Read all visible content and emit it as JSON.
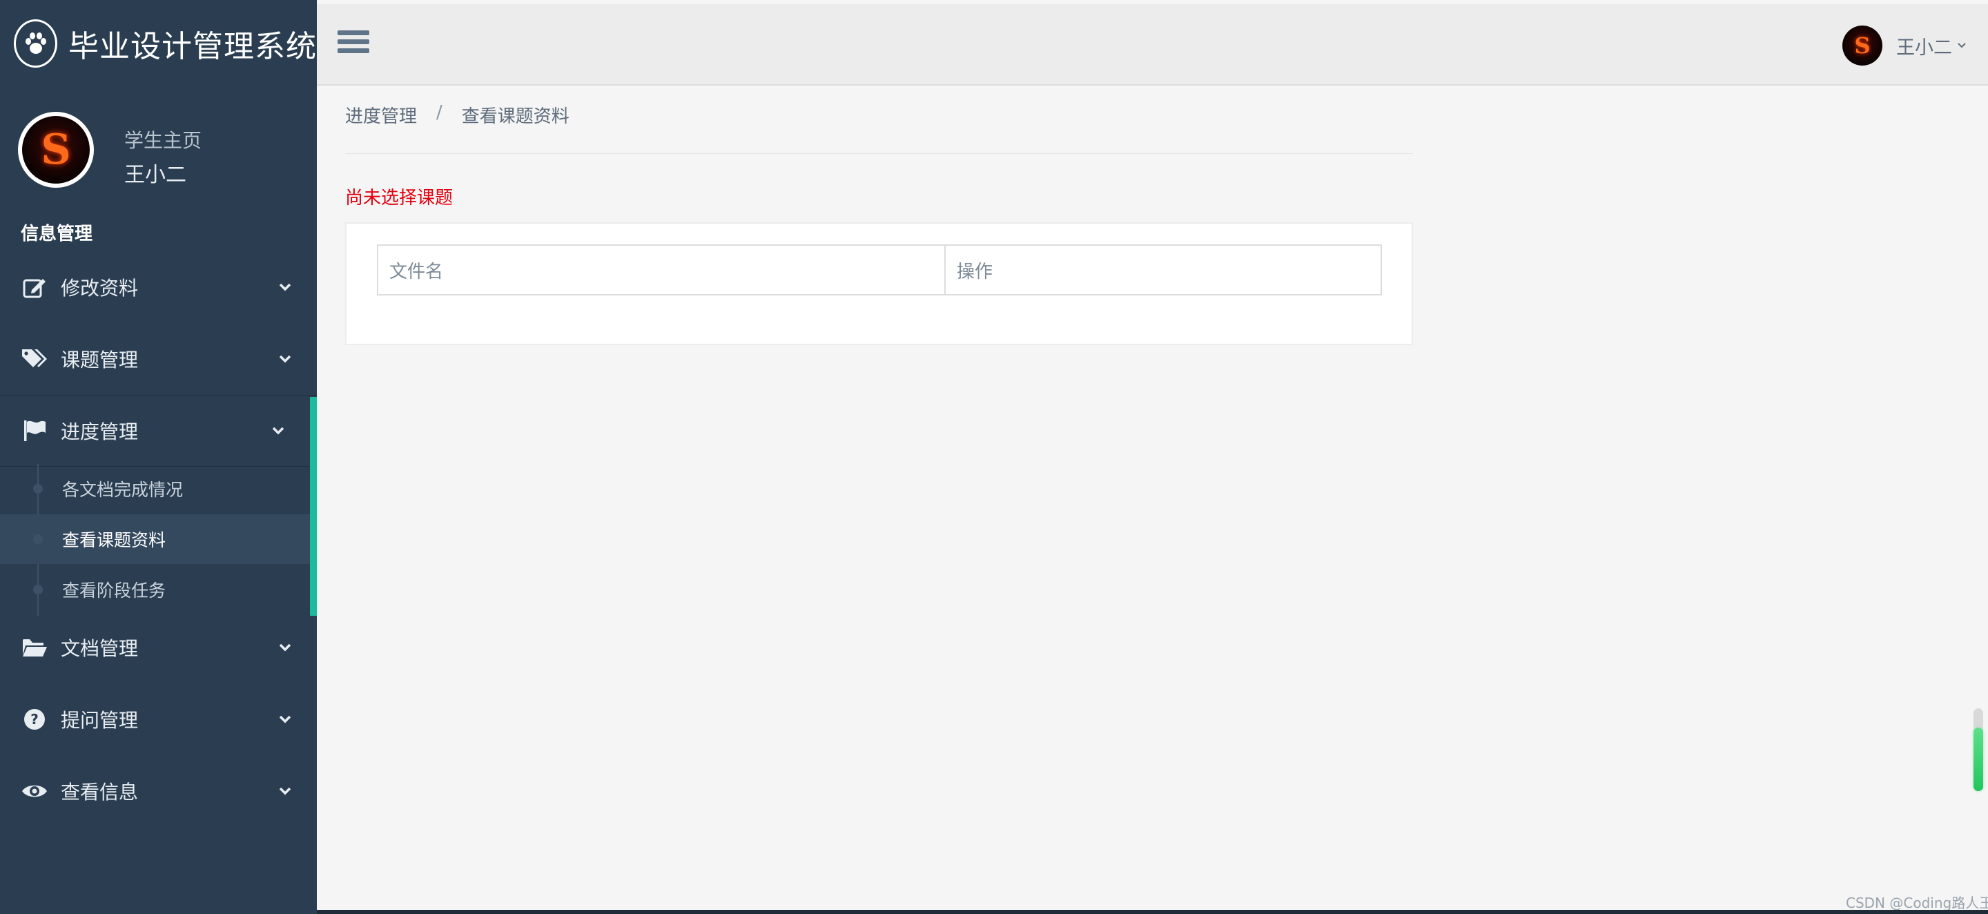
{
  "app": {
    "title": "毕业设计管理系统",
    "logo_icon": "paw-icon"
  },
  "profile": {
    "role": "学生主页",
    "name": "王小二",
    "avatar_letter": "S"
  },
  "sidebar": {
    "section_title": "信息管理",
    "items": [
      {
        "label": "修改资料",
        "icon": "edit-icon"
      },
      {
        "label": "课题管理",
        "icon": "tags-icon"
      },
      {
        "label": "进度管理",
        "icon": "flag-icon",
        "active": true
      },
      {
        "label": "文档管理",
        "icon": "folder-open-icon"
      },
      {
        "label": "提问管理",
        "icon": "question-circle-icon"
      },
      {
        "label": "查看信息",
        "icon": "eye-icon"
      }
    ],
    "submenu": [
      {
        "label": "各文档完成情况"
      },
      {
        "label": "查看课题资料",
        "current": true
      },
      {
        "label": "查看阶段任务"
      }
    ]
  },
  "topbar": {
    "user_name": "王小二",
    "avatar_letter": "S"
  },
  "breadcrumb": {
    "parent": "进度管理",
    "separator": "/",
    "current": "查看课题资料"
  },
  "main": {
    "warning": "尚未选择课题",
    "table": {
      "columns": [
        "文件名",
        "操作"
      ],
      "rows": []
    }
  },
  "watermark": "CSDN @Coding路人王",
  "colors": {
    "sidebar_bg": "#2b3e51",
    "active_accent": "#1abc9c",
    "warning_text": "#e4000f",
    "topbar_bg": "#ececec"
  }
}
